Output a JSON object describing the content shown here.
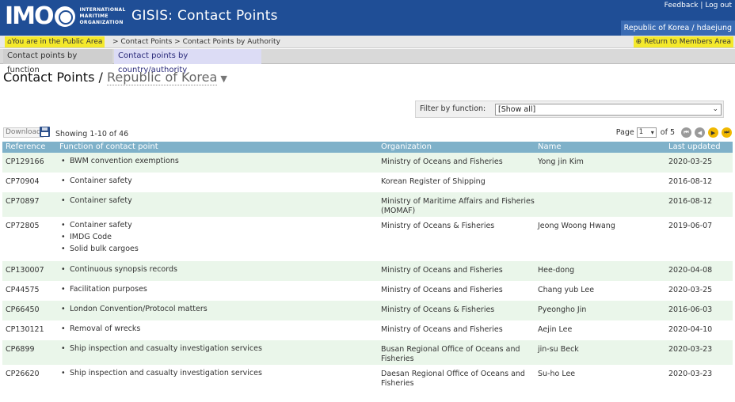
{
  "header": {
    "logo_text": "IMO",
    "logo_subtext": [
      "INTERNATIONAL",
      "MARITIME",
      "ORGANIZATION"
    ],
    "app_title": "GISIS: Contact Points",
    "feedback_link": "Feedback",
    "logout_link": "Log out",
    "user": "Republic of Korea / hdaejung"
  },
  "breadcrumb": {
    "public_area": "You are in the Public Area",
    "path": "> Contact Points > Contact Points by Authority",
    "members_link": "Return to Members Area"
  },
  "tabs": [
    {
      "label": "Contact points by function"
    },
    {
      "label": "Contact points by country/authority"
    }
  ],
  "page": {
    "title": "Contact Points /",
    "country": "Republic of Korea"
  },
  "filter": {
    "label": "Filter by function:",
    "value": "[Show all]"
  },
  "toolbar": {
    "download_label": "Download",
    "showing": "Showing 1-10 of 46",
    "page_label": "Page",
    "page_value": "1",
    "page_of": "of 5"
  },
  "table": {
    "columns": [
      "Reference",
      "Function of contact point",
      "Organization",
      "Name",
      "Last updated"
    ],
    "rows": [
      {
        "ref": "CP129166",
        "functions": [
          "BWM convention exemptions"
        ],
        "org": "Ministry of Oceans and Fisheries",
        "name": "Yong jin Kim",
        "date": "2020-03-25"
      },
      {
        "ref": "CP70904",
        "functions": [
          "Container safety"
        ],
        "org": "Korean Register of Shipping",
        "name": "",
        "date": "2016-08-12"
      },
      {
        "ref": "CP70897",
        "functions": [
          "Container safety"
        ],
        "org": "Ministry of Maritime Affairs and Fisheries (MOMAF)",
        "name": "",
        "date": "2016-08-12"
      },
      {
        "ref": "CP72805",
        "functions": [
          "Container safety",
          "IMDG Code",
          "Solid bulk cargoes"
        ],
        "org": "Ministry of Oceans & Fisheries",
        "name": "Jeong Woong Hwang",
        "date": "2019-06-07"
      },
      {
        "ref": "CP130007",
        "functions": [
          "Continuous synopsis records"
        ],
        "org": "Ministry of Oceans and Fisheries",
        "name": "Hee-dong",
        "date": "2020-04-08"
      },
      {
        "ref": "CP44575",
        "functions": [
          "Facilitation purposes"
        ],
        "org": "Ministry of Oceans and Fisheries",
        "name": "Chang yub Lee",
        "date": "2020-03-25"
      },
      {
        "ref": "CP66450",
        "functions": [
          "London Convention/Protocol matters"
        ],
        "org": "Ministry of Oceans & Fisheries",
        "name": "Pyeongho Jin",
        "date": "2016-06-03"
      },
      {
        "ref": "CP130121",
        "functions": [
          "Removal of wrecks"
        ],
        "org": "Ministry of Oceans and Fisheries",
        "name": "Aejin Lee",
        "date": "2020-04-10"
      },
      {
        "ref": "CP6899",
        "functions": [
          "Ship inspection and casualty investigation services"
        ],
        "org": "Busan Regional Office of Oceans and Fisheries",
        "name": "jin-su Beck",
        "date": "2020-03-23"
      },
      {
        "ref": "CP26620",
        "functions": [
          "Ship inspection and casualty investigation services"
        ],
        "org": "Daesan Regional Office of Oceans and Fisheries",
        "name": "Su-ho Lee",
        "date": "2020-03-23"
      }
    ]
  },
  "colors": {
    "header_bg": "#1f4e96",
    "highlight": "#f4e92b",
    "table_header": "#7fb1c9",
    "row_alt": "#eaf6ea"
  }
}
